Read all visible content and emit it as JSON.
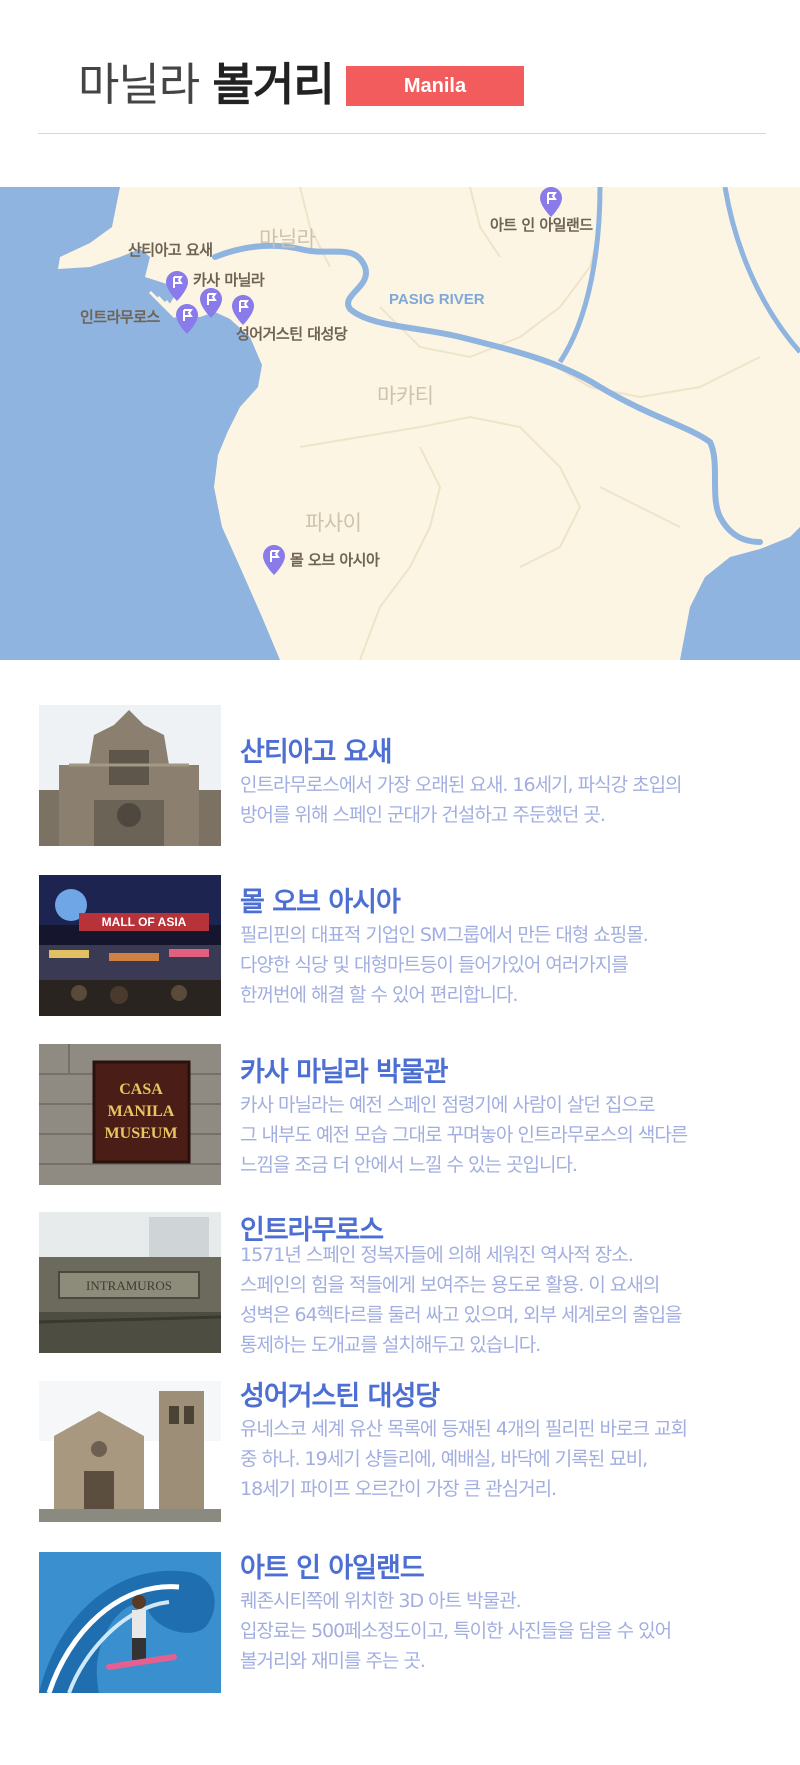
{
  "header": {
    "title_light": "마닐라",
    "title_bold": "볼거리",
    "badge": "Manila"
  },
  "map": {
    "colors": {
      "land": "#fdf5e3",
      "water": "#8fb4e0",
      "river": "#8fb4e0",
      "pin": "#8a7bea"
    },
    "labels": {
      "santiago": "산티아고 요새",
      "casa": "카사 마닐라",
      "intramuros": "인트라무로스",
      "augustine": "성어거스틴 대성당",
      "art": "아트 인 아일랜드",
      "mall": "몰 오브 아시아",
      "manila": "마닐라",
      "makati": "마카티",
      "pasay": "파사이",
      "river": "PASIG RIVER"
    }
  },
  "items": [
    {
      "title": "산티아고 요새",
      "desc": [
        "인트라무로스에서 가장 오래된 요새. 16세기, 파식강 초입의",
        "방어를 위해 스페인 군대가 건설하고 주둔했던 곳."
      ]
    },
    {
      "title": "몰 오브 아시아",
      "desc": [
        "필리핀의 대표적 기업인 SM그룹에서 만든 대형 쇼핑몰.",
        "다양한 식당 및 대형마트등이 들어가있어 여러가지를",
        "한꺼번에 해결 할 수 있어 편리합니다."
      ],
      "image_text": "MALL OF ASIA"
    },
    {
      "title": "카사 마닐라 박물관",
      "desc": [
        "카사 마닐라는 예전 스페인 점령기에 사람이 살던 집으로",
        "그 내부도 예전 모습 그대로 꾸며놓아 인트라무로스의 색다른",
        "느낌을  조금 더 안에서 느낄 수 있는 곳입니다."
      ],
      "image_text": [
        "CASA",
        "MANILA",
        "MUSEUM"
      ]
    },
    {
      "title": "인트라무로스",
      "desc": [
        "1571년 스페인 정복자들에 의해 세워진 역사적 장소.",
        "스페인의 힘을 적들에게 보여주는 용도로 활용. 이 요새의",
        "성벽은 64헥타르를 둘러 싸고 있으며, 외부 세계로의 출입을",
        "통제하는 도개교를 설치해두고 있습니다."
      ],
      "image_text": "INTRAMUROS"
    },
    {
      "title": "성어거스틴 대성당",
      "desc": [
        "유네스코 세계 유산 목록에 등재된 4개의 필리핀 바로크 교회",
        "중 하나. 19세기 샹들리에, 예배실, 바닥에 기록된 묘비,",
        "18세기 파이프 오르간이 가장 큰 관심거리."
      ]
    },
    {
      "title": "아트 인 아일랜드",
      "desc": [
        "퀘존시티쪽에 위치한 3D 아트 박물관.",
        "입장료는 500페소정도이고, 특이한 사진들을 담을 수 있어",
        "볼거리와 재미를 주는 곳."
      ]
    }
  ]
}
